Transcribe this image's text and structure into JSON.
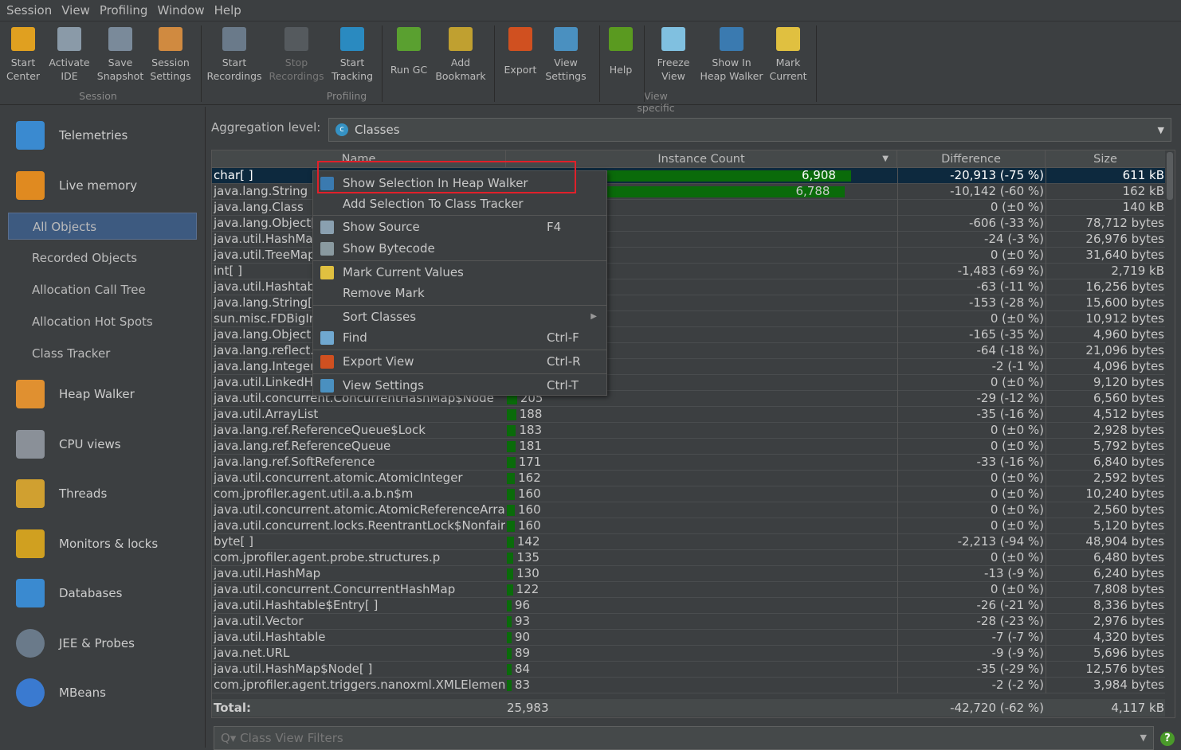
{
  "menubar": [
    "Session",
    "View",
    "Profiling",
    "Window",
    "Help"
  ],
  "toolbar": {
    "buttons": [
      {
        "l1": "Start",
        "l2": "Center",
        "icon": "start-center-icon",
        "color": "#e0a020"
      },
      {
        "l1": "Activate",
        "l2": "IDE",
        "icon": "activate-ide-icon",
        "color": "#8a9aa8"
      },
      {
        "l1": "Save",
        "l2": "Snapshot",
        "icon": "save-snapshot-icon",
        "color": "#7a8a9a"
      },
      {
        "l1": "Session",
        "l2": "Settings",
        "icon": "session-settings-icon",
        "color": "#d08a40"
      },
      {
        "l1": "Start",
        "l2": "Recordings",
        "icon": "start-recordings-icon",
        "color": "#6a7a8a"
      },
      {
        "l1": "Stop",
        "l2": "Recordings",
        "icon": "stop-recordings-icon",
        "color": "#555a5e",
        "disabled": true
      },
      {
        "l1": "Start",
        "l2": "Tracking",
        "icon": "start-tracking-icon",
        "color": "#2a8ac0"
      },
      {
        "l1": "Run GC",
        "l2": "",
        "icon": "run-gc-icon",
        "color": "#5aa030"
      },
      {
        "l1": "Add",
        "l2": "Bookmark",
        "icon": "add-bookmark-icon",
        "color": "#c0a030"
      },
      {
        "l1": "Export",
        "l2": "",
        "icon": "export-icon",
        "color": "#d05020"
      },
      {
        "l1": "View",
        "l2": "Settings",
        "icon": "view-settings-icon",
        "color": "#4a90c0"
      },
      {
        "l1": "Help",
        "l2": "",
        "icon": "help-icon",
        "color": "#5a9a20"
      },
      {
        "l1": "Freeze",
        "l2": "View",
        "icon": "freeze-snowflake-icon",
        "color": "#80c0e0"
      },
      {
        "l1": "Show In",
        "l2": "Heap Walker",
        "icon": "camera-icon",
        "color": "#3a7ab0"
      },
      {
        "l1": "Mark",
        "l2": "Current",
        "icon": "sticky-note-icon",
        "color": "#e0c040"
      }
    ],
    "groups": [
      "Session",
      "Profiling",
      "View specific"
    ]
  },
  "sidebar": {
    "items": [
      {
        "label": "Telemetries",
        "icon": "telemetries-icon",
        "color": "#3a8ad0"
      },
      {
        "label": "Live memory",
        "icon": "live-memory-icon",
        "color": "#e08a20"
      },
      {
        "label": "Heap Walker",
        "icon": "heap-walker-icon",
        "color": "#e09030"
      },
      {
        "label": "CPU views",
        "icon": "cpu-icon",
        "color": "#8a9098"
      },
      {
        "label": "Threads",
        "icon": "threads-icon",
        "color": "#d0a030"
      },
      {
        "label": "Monitors & locks",
        "icon": "lock-icon",
        "color": "#d0a020"
      },
      {
        "label": "Databases",
        "icon": "database-icon",
        "color": "#3a8ad0"
      },
      {
        "label": "JEE & Probes",
        "icon": "probe-gauge-icon",
        "color": "#6a7a8a"
      },
      {
        "label": "MBeans",
        "icon": "globe-icon",
        "color": "#3a7ad0"
      }
    ],
    "sub": [
      "All Objects",
      "Recorded Objects",
      "Allocation Call Tree",
      "Allocation Hot Spots",
      "Class Tracker"
    ]
  },
  "aggregation": {
    "label": "Aggregation level:",
    "value": "Classes"
  },
  "table": {
    "columns": [
      "Name",
      "Instance Count",
      "Difference",
      "Size"
    ],
    "max_count": 6908,
    "rows": [
      [
        "char[ ]",
        6908,
        "-20,913 (-75 %)",
        "611 kB"
      ],
      [
        "java.lang.String",
        6788,
        "-10,142 (-60 %)",
        "162 kB"
      ],
      [
        "java.lang.Class",
        null,
        "0 (±0 %)",
        "140 kB"
      ],
      [
        "java.lang.Object[",
        null,
        "-606 (-33 %)",
        "78,712 bytes"
      ],
      [
        "java.util.HashMap",
        null,
        "-24 (-3 %)",
        "26,976 bytes"
      ],
      [
        "java.util.TreeMap",
        null,
        "0 (±0 %)",
        "31,640 bytes"
      ],
      [
        "int[ ]",
        null,
        "-1,483 (-69 %)",
        "2,719 kB"
      ],
      [
        "java.util.Hashtabl",
        null,
        "-63 (-11 %)",
        "16,256 bytes"
      ],
      [
        "java.lang.String[ ]",
        null,
        "-153 (-28 %)",
        "15,600 bytes"
      ],
      [
        "sun.misc.FDBigInt",
        null,
        "0 (±0 %)",
        "10,912 bytes"
      ],
      [
        "java.lang.Object",
        null,
        "-165 (-35 %)",
        "4,960 bytes"
      ],
      [
        "java.lang.reflect.F",
        null,
        "-64 (-18 %)",
        "21,096 bytes"
      ],
      [
        "java.lang.Integer",
        null,
        "-2 (-1 %)",
        "4,096 bytes"
      ],
      [
        "java.util.LinkedHa",
        null,
        "0 (±0 %)",
        "9,120 bytes"
      ],
      [
        "java.util.concurrent.ConcurrentHashMap$Node",
        205,
        "-29 (-12 %)",
        "6,560 bytes"
      ],
      [
        "java.util.ArrayList",
        188,
        "-35 (-16 %)",
        "4,512 bytes"
      ],
      [
        "java.lang.ref.ReferenceQueue$Lock",
        183,
        "0 (±0 %)",
        "2,928 bytes"
      ],
      [
        "java.lang.ref.ReferenceQueue",
        181,
        "0 (±0 %)",
        "5,792 bytes"
      ],
      [
        "java.lang.ref.SoftReference",
        171,
        "-33 (-16 %)",
        "6,840 bytes"
      ],
      [
        "java.util.concurrent.atomic.AtomicInteger",
        162,
        "0 (±0 %)",
        "2,592 bytes"
      ],
      [
        "com.jprofiler.agent.util.a.a.b.n$m",
        160,
        "0 (±0 %)",
        "10,240 bytes"
      ],
      [
        "java.util.concurrent.atomic.AtomicReferenceArray",
        160,
        "0 (±0 %)",
        "2,560 bytes"
      ],
      [
        "java.util.concurrent.locks.ReentrantLock$Nonfair...",
        160,
        "0 (±0 %)",
        "5,120 bytes"
      ],
      [
        "byte[ ]",
        142,
        "-2,213 (-94 %)",
        "48,904 bytes"
      ],
      [
        "com.jprofiler.agent.probe.structures.p",
        135,
        "0 (±0 %)",
        "6,480 bytes"
      ],
      [
        "java.util.HashMap",
        130,
        "-13 (-9 %)",
        "6,240 bytes"
      ],
      [
        "java.util.concurrent.ConcurrentHashMap",
        122,
        "0 (±0 %)",
        "7,808 bytes"
      ],
      [
        "java.util.Hashtable$Entry[ ]",
        96,
        "-26 (-21 %)",
        "8,336 bytes"
      ],
      [
        "java.util.Vector",
        93,
        "-28 (-23 %)",
        "2,976 bytes"
      ],
      [
        "java.util.Hashtable",
        90,
        "-7 (-7 %)",
        "4,320 bytes"
      ],
      [
        "java.net.URL",
        89,
        "-9 (-9 %)",
        "5,696 bytes"
      ],
      [
        "java.util.HashMap$Node[ ]",
        84,
        "-35 (-29 %)",
        "12,576 bytes"
      ],
      [
        "com.jprofiler.agent.triggers.nanoxml.XMLElement",
        83,
        "-2 (-2 %)",
        "3,984 bytes"
      ]
    ],
    "total": {
      "label": "Total:",
      "count": "25,983",
      "difference": "-42,720 (-62 %)",
      "size": "4,117 kB"
    }
  },
  "context_menu": [
    {
      "label": "Show Selection In Heap Walker",
      "key": "",
      "icon": "camera-icon",
      "color": "#3a7ab0",
      "sep": false
    },
    {
      "label": "Add Selection To Class Tracker",
      "key": "",
      "icon": "",
      "sep": false
    },
    {
      "label": "Show Source",
      "key": "F4",
      "icon": "source-file-icon",
      "color": "#8aa0b0",
      "sep": true
    },
    {
      "label": "Show Bytecode",
      "key": "",
      "icon": "bytecode-icon",
      "color": "#8a9aa0",
      "sep": false
    },
    {
      "label": "Mark Current Values",
      "key": "",
      "icon": "sticky-note-icon",
      "color": "#e0c040",
      "sep": true
    },
    {
      "label": "Remove Mark",
      "key": "",
      "icon": "",
      "sep": false
    },
    {
      "label": "Sort Classes",
      "key": "",
      "icon": "",
      "submenu": true,
      "sep": true
    },
    {
      "label": "Find",
      "key": "Ctrl-F",
      "icon": "magnifier-icon",
      "color": "#70a8d0",
      "sep": false
    },
    {
      "label": "Export View",
      "key": "Ctrl-R",
      "icon": "export-icon",
      "color": "#d05020",
      "sep": true
    },
    {
      "label": "View Settings",
      "key": "Ctrl-T",
      "icon": "view-settings-icon",
      "color": "#4a90c0",
      "sep": true
    }
  ],
  "filter": {
    "placeholder": "Class View Filters"
  },
  "colors": {
    "accent": "#0d293e",
    "bar": "#0a6b0a",
    "highlight": "#e0202a"
  }
}
